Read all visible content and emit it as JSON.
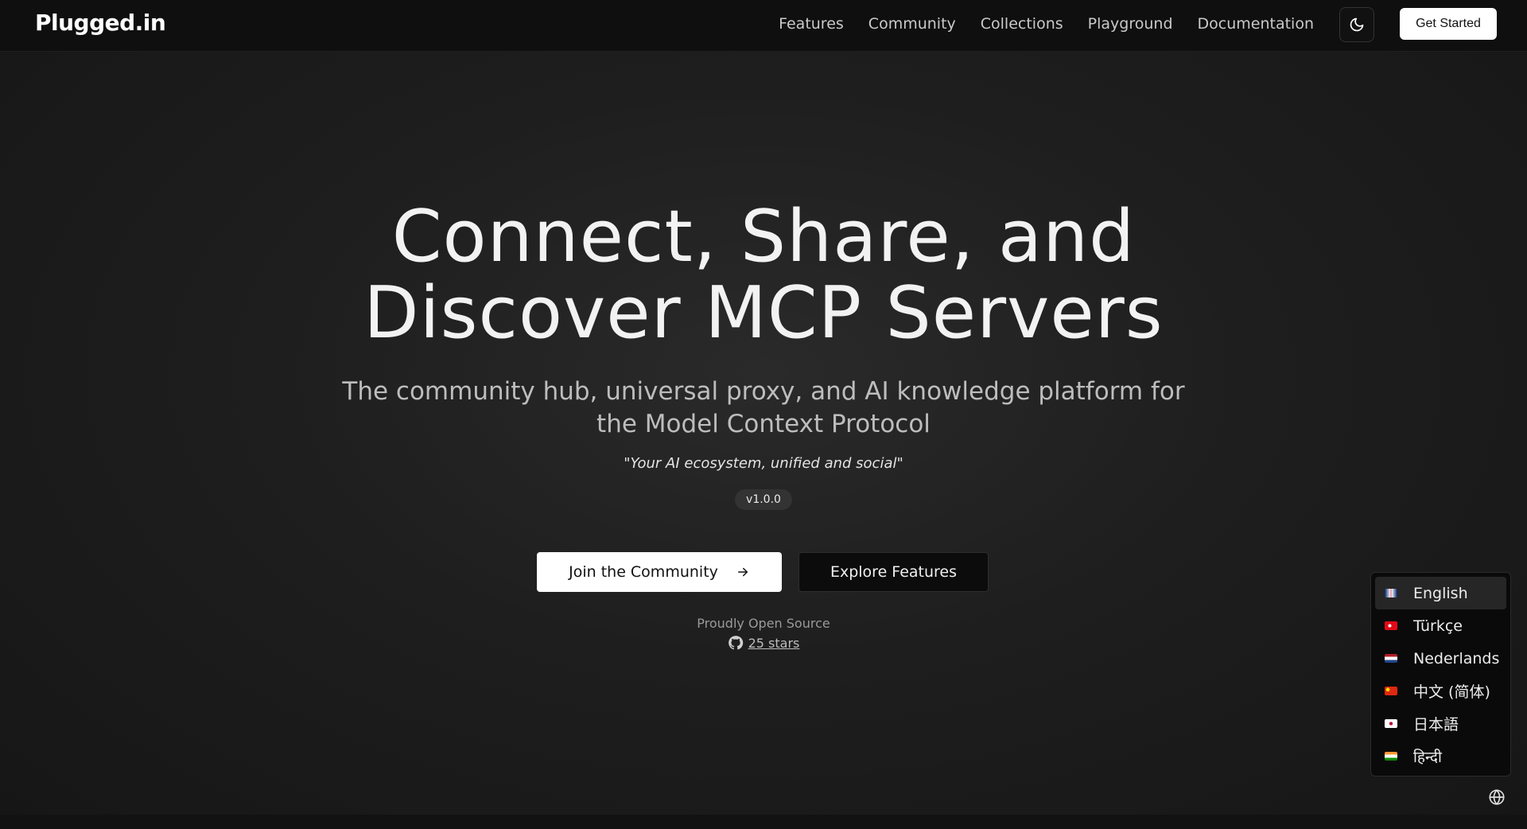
{
  "nav": {
    "logo": "Plugged.in",
    "links": [
      "Features",
      "Community",
      "Collections",
      "Playground",
      "Documentation"
    ],
    "theme_icon": "moon-icon",
    "cta_label": "Get Started"
  },
  "hero": {
    "title_line1": "Connect, Share, and",
    "title_line2": "Discover MCP Servers",
    "subtitle_line1": "The community hub, universal proxy, and AI knowledge platform for",
    "subtitle_line2": "the Model Context Protocol",
    "tagline": "\"Your AI ecosystem, unified and social\"",
    "version": "v1.0.0"
  },
  "actions": {
    "primary_label": "Join the Community",
    "primary_icon": "arrow-right-icon",
    "secondary_label": "Explore Features"
  },
  "open_source": {
    "label": "Proudly Open Source",
    "icon": "github-icon",
    "stars": "25 stars"
  },
  "language_menu": {
    "selected": "English",
    "items": [
      {
        "label": "English",
        "flag_colors": [
          "#012169",
          "#ffffff",
          "#c8102e"
        ]
      },
      {
        "label": "Türkçe",
        "flag_colors": [
          "#e30a17",
          "#ffffff",
          "#e30a17"
        ]
      },
      {
        "label": "Nederlands",
        "flag_colors": [
          "#ae1c28",
          "#ffffff",
          "#21468b"
        ]
      },
      {
        "label": "中文 (简体)",
        "flag_colors": [
          "#de2910",
          "#ffde00",
          "#de2910"
        ]
      },
      {
        "label": "日本語",
        "flag_colors": [
          "#ffffff",
          "#bc002d",
          "#ffffff"
        ]
      },
      {
        "label": "हिन्दी",
        "flag_colors": [
          "#ff9933",
          "#ffffff",
          "#138808"
        ]
      }
    ],
    "toggle_icon": "globe-icon"
  }
}
